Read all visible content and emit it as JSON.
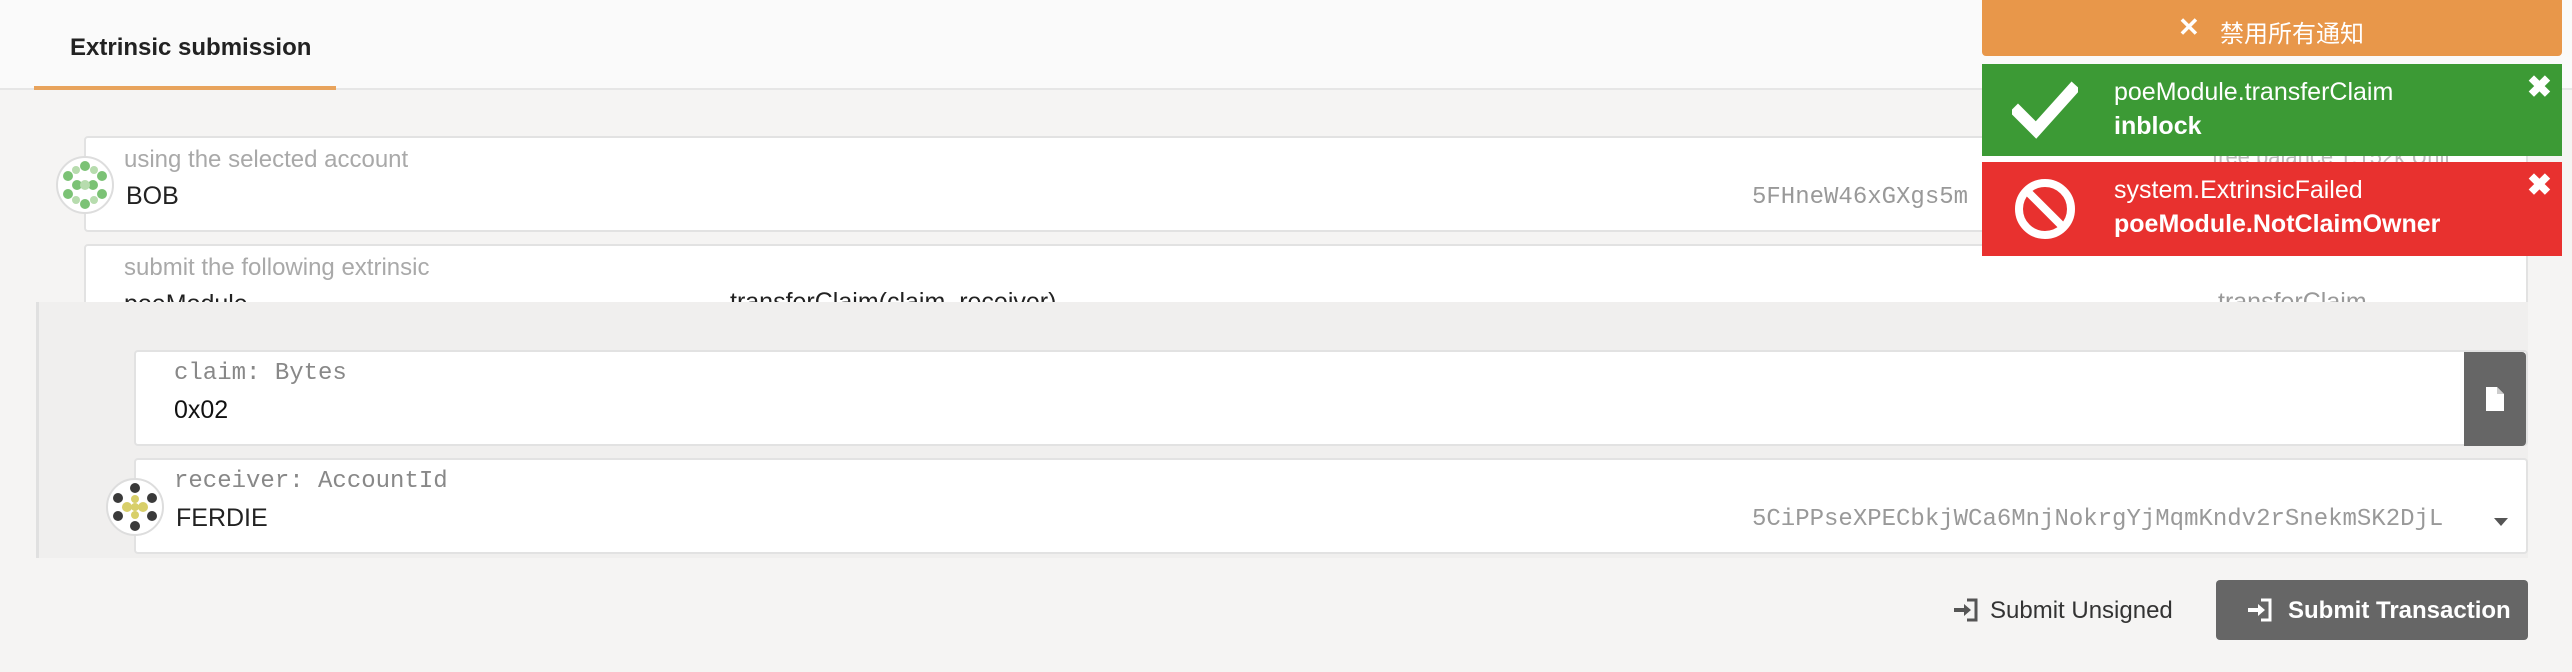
{
  "tabs": [
    {
      "label": "Extrinsic submission"
    }
  ],
  "account": {
    "label": "using the selected account",
    "name": "BOB",
    "address": "5FHneW46xGXgs5m",
    "balance": "free balance 1.152k Unit"
  },
  "extrinsic": {
    "label": "submit the following extrinsic",
    "module": "poeModule",
    "signature": "transferClaim(claim, receiver)",
    "method": "transferClaim"
  },
  "params": {
    "claim": {
      "label": "claim: Bytes",
      "value": "0x02"
    },
    "receiver": {
      "label": "receiver: AccountId",
      "name": "FERDIE",
      "address": "5CiPPseXPECbkjWCa6MnjNokrgYjMqmKndv2rSnekmSK2DjL"
    }
  },
  "actions": {
    "unsigned": "Submit Unsigned",
    "submit": "Submit Transaction"
  },
  "notifications": {
    "dismiss_all": "禁用所有通知",
    "items": [
      {
        "title": "poeModule.transferClaim",
        "status": "inblock",
        "color": "#3c9a35"
      },
      {
        "title": "system.ExtrinsicFailed",
        "status": "poeModule.NotClaimOwner",
        "color": "#e8312f"
      }
    ]
  }
}
